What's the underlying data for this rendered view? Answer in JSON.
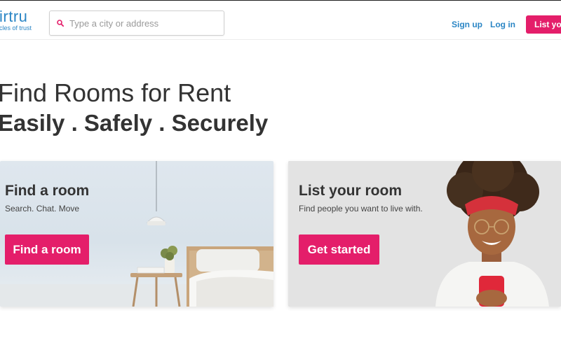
{
  "header": {
    "logo_word": "irtru",
    "logo_tagline": "cles of trust",
    "search_placeholder": "Type a city or address",
    "signup_label": "Sign up",
    "login_label": "Log in",
    "list_button_label": "List you"
  },
  "hero": {
    "title": "Find Rooms for Rent",
    "subtitle": "Easily . Safely . Securely"
  },
  "cards": {
    "find": {
      "title": "Find a room",
      "description": "Search. Chat. Move",
      "button_label": "Find a room"
    },
    "list": {
      "title": "List your room",
      "description": "Find people you want to live with.",
      "button_label": "Get started"
    }
  },
  "colors": {
    "brand_pink": "#e41e6a",
    "link_blue": "#2b86c5"
  }
}
